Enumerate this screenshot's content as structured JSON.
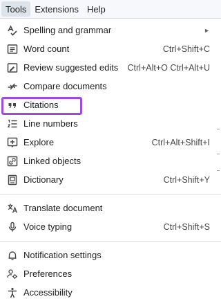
{
  "menubar": {
    "items": [
      {
        "label": "Tools"
      },
      {
        "label": "Extensions"
      },
      {
        "label": "Help"
      }
    ]
  },
  "menu": {
    "groups": [
      [
        {
          "label": "Spelling and grammar",
          "icon": "spellcheck-icon",
          "submenu": true
        },
        {
          "label": "Word count",
          "icon": "word-count-icon",
          "shortcut": "Ctrl+Shift+C"
        },
        {
          "label": "Review suggested edits",
          "icon": "review-edits-icon",
          "shortcut": "Ctrl+Alt+O Ctrl+Alt+U"
        },
        {
          "label": "Compare documents",
          "icon": "compare-icon"
        },
        {
          "label": "Citations",
          "icon": "quote-icon"
        },
        {
          "label": "Line numbers",
          "icon": "line-numbers-icon",
          "highlighted": true
        },
        {
          "label": "Explore",
          "icon": "explore-icon",
          "shortcut": "Ctrl+Alt+Shift+I"
        },
        {
          "label": "Linked objects",
          "icon": "link-objects-icon"
        },
        {
          "label": "Dictionary",
          "icon": "dictionary-icon",
          "shortcut": "Ctrl+Shift+Y"
        }
      ],
      [
        {
          "label": "Translate document",
          "icon": "translate-icon"
        },
        {
          "label": "Voice typing",
          "icon": "microphone-icon",
          "shortcut": "Ctrl+Shift+S"
        }
      ],
      [
        {
          "label": "Notification settings",
          "icon": "bell-icon"
        },
        {
          "label": "Preferences",
          "icon": "preferences-icon"
        },
        {
          "label": "Accessibility",
          "icon": "accessibility-icon"
        }
      ]
    ]
  },
  "colors": {
    "highlight_border": "#9b4fd9",
    "menubar_bg": "#f6f8fc",
    "active_menu_bg": "#dde3ea"
  }
}
